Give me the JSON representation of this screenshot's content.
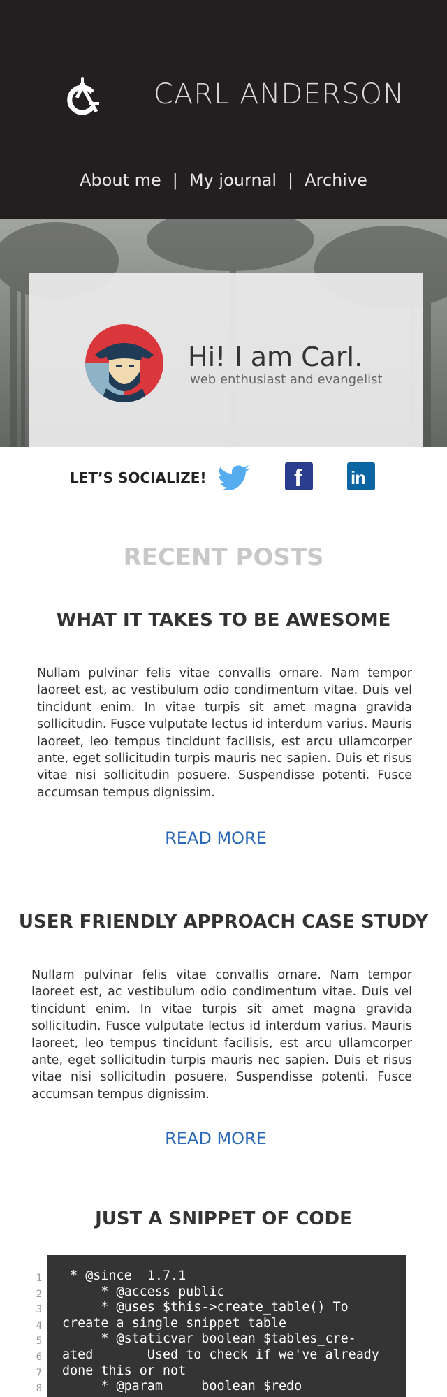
{
  "header": {
    "logo_alt": "CA",
    "title": "CARL ANDERSON",
    "nav": [
      {
        "label": "About me"
      },
      {
        "label": "My journal"
      },
      {
        "label": "Archive"
      }
    ],
    "nav_separator": "|"
  },
  "hero": {
    "greeting": "Hi! I am Carl.",
    "tagline": "web enthusiast and evangelist",
    "avatar_icon": "portrait-avatar"
  },
  "social": {
    "label": "LET’S SOCIALIZE!",
    "icons": [
      "twitter-icon",
      "facebook-icon",
      "linkedin-icon"
    ],
    "facebook_glyph": "f",
    "linkedin_glyph": "in"
  },
  "posts": {
    "section_title": "RECENT POSTS",
    "items": [
      {
        "title": "WHAT IT TAKES TO BE AWESOME",
        "body": "Nullam pulvinar felis vitae convallis ornare. Nam tempor laoreet est, ac vestibulum odio condimentum vitae. Duis vel tincidunt enim. In vitae turpis sit amet magna gravida sollicitudin. Fusce vulputate lectus id interdum varius. Mauris laoreet, leo tempus tincidunt facilisis, est arcu ullamcorper ante, eget sollicitudin turpis mauris nec sapien. Duis et risus vitae nisi sollicitudin posuere. Suspendisse potenti. Fusce accumsan tempus dignis­sim.",
        "read_more": "READ MORE"
      },
      {
        "title": "USER FRIENDLY APPROACH CASE STUDY",
        "body": "Nullam pulvinar felis vitae convallis ornare. Nam tempor laoreet est, ac vestibulum odio condimentum vitae. Duis vel tincidunt enim. In vitae turpis sit amet magna gravida sollicitudin. Fusce vulputate lectus id interdum varius. Mauris laoreet, leo tempus tin­cidunt facilisis, est arcu ullamcorper ante, eget sollicitudin turpis mauris nec sapien. Duis et risus vitae nisi sollicitudin posuere. Sus­pendisse potenti. Fusce accumsan tempus dignissim.",
        "read_more": "READ MORE"
      },
      {
        "title": "JUST A SNIPPET OF CODE"
      }
    ]
  },
  "code": {
    "line_numbers": [
      "1",
      "2",
      "3",
      "4",
      "5",
      "6",
      "7",
      "8"
    ],
    "lines": [
      " * @since  1.7.1",
      "     * @access public",
      "     * @uses $this->create_table() To",
      "create a single snippet table",
      "     * @staticvar boolean $tables_cre-",
      "ated       Used to check if we've already",
      "done this or not",
      "     * @param     boolean $redo"
    ]
  },
  "colors": {
    "header_bg": "#231f20",
    "link_blue": "#2a68b8",
    "code_bg": "#343434",
    "twitter": "#55acee",
    "facebook": "#2b3d8f",
    "linkedin": "#0b65a3"
  }
}
